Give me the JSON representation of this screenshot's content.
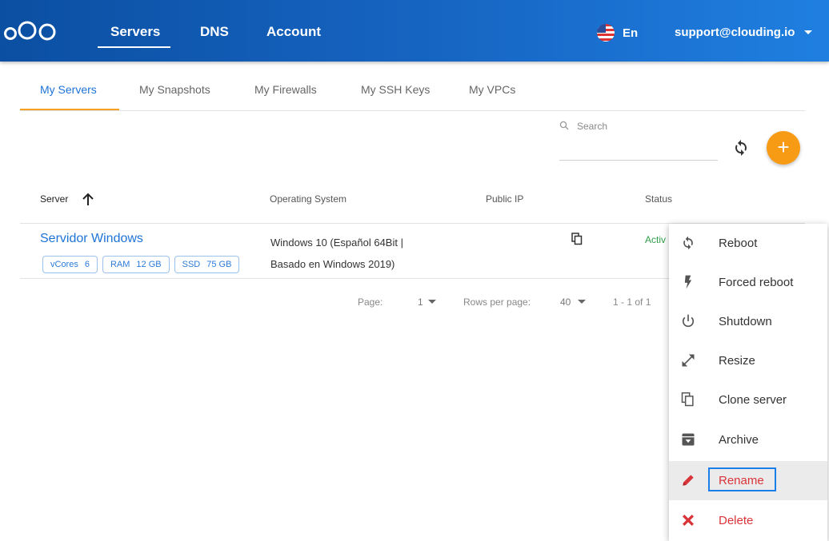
{
  "nav": {
    "items": [
      "Servers",
      "DNS",
      "Account"
    ],
    "language": "En",
    "user_email": "support@clouding.io"
  },
  "subtabs": [
    "My Servers",
    "My Snapshots",
    "My Firewalls",
    "My SSH Keys",
    "My VPCs"
  ],
  "search": {
    "placeholder": "Search"
  },
  "table": {
    "headers": {
      "server": "Server",
      "os": "Operating System",
      "public_ip": "Public IP",
      "status": "Status"
    },
    "rows": [
      {
        "name": "Servidor Windows",
        "specs": [
          {
            "label": "vCores",
            "value": "6"
          },
          {
            "label": "RAM",
            "value": "12 GB"
          },
          {
            "label": "SSD",
            "value": "75 GB"
          }
        ],
        "os_line1": "Windows 10 (Español 64Bit |",
        "os_line2": "Basado en Windows 2019)",
        "status": "Activ"
      }
    ]
  },
  "pagination": {
    "page_label": "Page:",
    "page_value": "1",
    "rows_label": "Rows per page:",
    "rows_value": "40",
    "range": "1 - 1 of 1"
  },
  "menu": [
    {
      "label": "Reboot",
      "icon": "reboot-icon"
    },
    {
      "label": "Forced reboot",
      "icon": "bolt-icon"
    },
    {
      "label": "Shutdown",
      "icon": "power-icon"
    },
    {
      "label": "Resize",
      "icon": "resize-icon"
    },
    {
      "label": "Clone server",
      "icon": "clone-icon"
    },
    {
      "label": "Archive",
      "icon": "archive-icon"
    },
    {
      "label": "Rename",
      "icon": "pencil-icon"
    },
    {
      "label": "Delete",
      "icon": "close-icon"
    }
  ],
  "colors": {
    "header": "#1766c4",
    "accent": "#f79a14",
    "link": "#1e73d6",
    "danger": "#d9343a",
    "status_active": "#2e9e4a"
  }
}
